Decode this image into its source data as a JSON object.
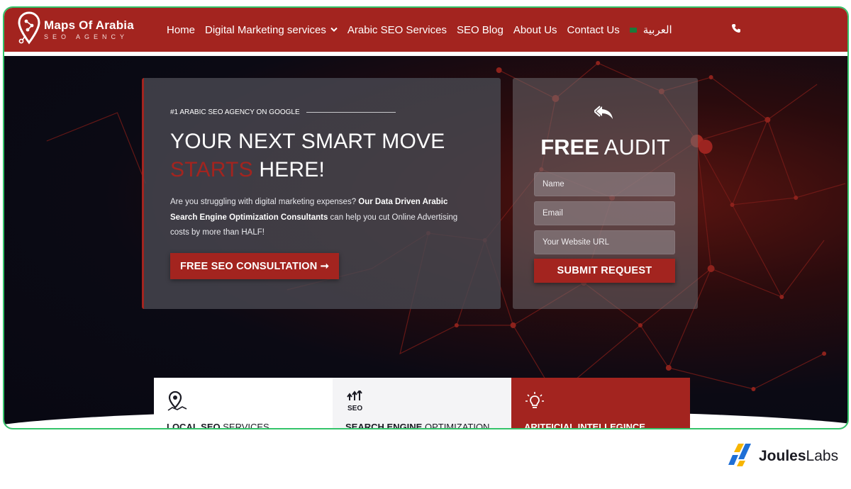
{
  "brand": {
    "title": "Maps Of Arabia",
    "subtitle": "SEO AGENCY"
  },
  "nav": {
    "items": [
      {
        "label": "Home"
      },
      {
        "label": "Digital Marketing services",
        "has_dropdown": true
      },
      {
        "label": "Arabic SEO Services"
      },
      {
        "label": "SEO Blog"
      },
      {
        "label": "About Us"
      },
      {
        "label": "Contact Us"
      },
      {
        "label": "العربية",
        "icon": "flag-icon"
      }
    ],
    "phone_icon": "phone-icon"
  },
  "hero": {
    "eyebrow": "#1 ARABIC SEO AGENCY ON GOOGLE",
    "headline_line1": "YOUR NEXT SMART MOVE",
    "headline_accent": "STARTS",
    "headline_rest": " HERE!",
    "desc_intro": "Are you struggling with digital marketing expenses? ",
    "desc_bold": "Our Data Driven Arabic Search Engine Optimization Consultants",
    "desc_outro": " can help you cut Online Advertising costs by more than HALF!",
    "cta_label": "FREE SEO CONSULTATION ➞"
  },
  "audit": {
    "title_bold": "FREE",
    "title_rest": " AUDIT",
    "name_placeholder": "Name",
    "email_placeholder": "Email",
    "url_placeholder": "Your Website URL",
    "submit_label": "SUBMIT REQUEST"
  },
  "services": [
    {
      "bold": "LOCAL SEO",
      "rest": " SERVICES",
      "icon": "map-pin-icon"
    },
    {
      "bold": "SEARCH ENGINE",
      "rest": " OPTIMIZATION",
      "icon": "seo-arrows-icon",
      "icon_text": "SEO"
    },
    {
      "bold": "ARITFICIAL INTELLEGINCE",
      "rest": "",
      "icon": "lightbulb-icon"
    }
  ],
  "footer_brand": {
    "name_bold": "Joules",
    "name_rest": "Labs"
  },
  "colors": {
    "primary": "#a3241f",
    "frame_border": "#34c46a",
    "hero_bg": "#0b0a14"
  }
}
